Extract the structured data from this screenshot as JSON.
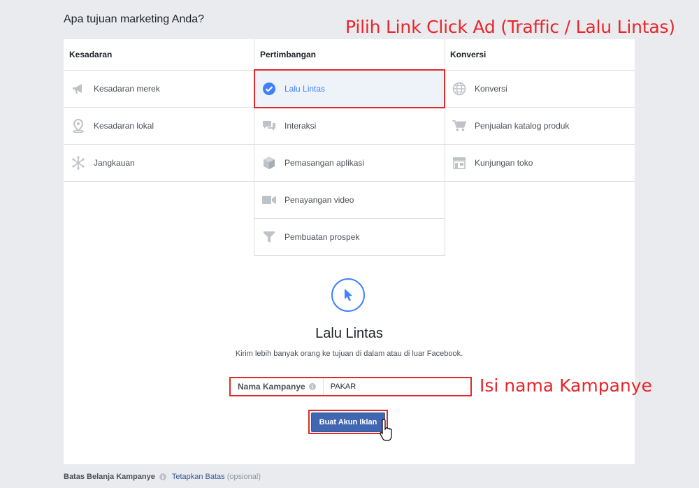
{
  "question": "Apa tujuan marketing Anda?",
  "annotations": {
    "top": "Pilih Link Click Ad (Traffic / Lalu Lintas)",
    "name": "Isi nama Kampanye"
  },
  "columns": {
    "awareness": {
      "header": "Kesadaran",
      "options": [
        {
          "label": "Kesadaran merek",
          "icon": "megaphone-icon"
        },
        {
          "label": "Kesadaran lokal",
          "icon": "map-pin-icon"
        },
        {
          "label": "Jangkauan",
          "icon": "reach-icon"
        }
      ]
    },
    "consideration": {
      "header": "Pertimbangan",
      "options": [
        {
          "label": "Lalu Lintas",
          "icon": "check-circle-icon",
          "selected": true
        },
        {
          "label": "Interaksi",
          "icon": "chat-bubbles-icon"
        },
        {
          "label": "Pemasangan aplikasi",
          "icon": "cube-icon"
        },
        {
          "label": "Penayangan video",
          "icon": "video-camera-icon"
        },
        {
          "label": "Pembuatan prospek",
          "icon": "funnel-icon"
        }
      ]
    },
    "conversion": {
      "header": "Konversi",
      "options": [
        {
          "label": "Konversi",
          "icon": "globe-icon"
        },
        {
          "label": "Penjualan katalog produk",
          "icon": "cart-icon"
        },
        {
          "label": "Kunjungan toko",
          "icon": "store-icon"
        }
      ]
    }
  },
  "detail": {
    "title": "Lalu Lintas",
    "description": "Kirim lebih banyak orang ke tujuan di dalam atau di luar Facebook.",
    "icon": "cursor-arrow-icon"
  },
  "campaign_name": {
    "label": "Nama Kampanye",
    "value": "PAKAR"
  },
  "create_button": "Buat Akun Iklan",
  "footer": {
    "label": "Batas Belanja Kampanye",
    "link": "Tetapkan Batas",
    "optional": "(opsional)"
  },
  "colors": {
    "accent": "#4080ff",
    "button": "#4267b2",
    "annotation": "#e8262b",
    "icon_gray": "#bec3c9"
  }
}
